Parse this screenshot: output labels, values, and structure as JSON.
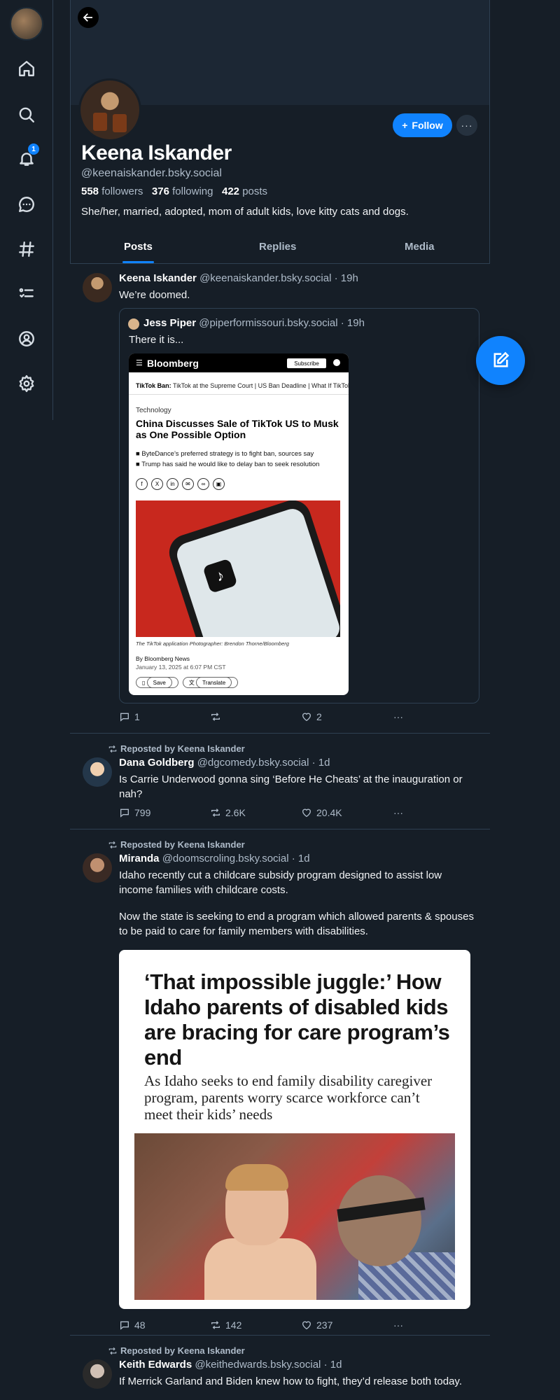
{
  "nav": {
    "items": [
      {
        "name": "home",
        "icon": "home-icon"
      },
      {
        "name": "search",
        "icon": "search-icon"
      },
      {
        "name": "notifications",
        "icon": "bell-icon",
        "badge": "1"
      },
      {
        "name": "chat",
        "icon": "chat-icon"
      },
      {
        "name": "feeds",
        "icon": "hashtag-icon"
      },
      {
        "name": "lists",
        "icon": "list-icon"
      },
      {
        "name": "profile",
        "icon": "user-icon"
      },
      {
        "name": "settings",
        "icon": "gear-icon"
      }
    ]
  },
  "profile": {
    "display_name": "Keena Iskander",
    "handle": "@keenaiskander.bsky.social",
    "followers_count": "558",
    "followers_label": "followers",
    "following_count": "376",
    "following_label": "following",
    "posts_count": "422",
    "posts_label": "posts",
    "bio": "She/her, married, adopted, mom of adult kids, love kitty cats and dogs.",
    "follow_label": "Follow",
    "more_label": "···"
  },
  "tabs": [
    {
      "label": "Posts",
      "active": true
    },
    {
      "label": "Replies",
      "active": false
    },
    {
      "label": "Media",
      "active": false
    }
  ],
  "posts": [
    {
      "author": "Keena Iskander",
      "handle": "@keenaiskander.bsky.social",
      "time": "· 19h",
      "text": "We’re doomed.",
      "quote": {
        "author": "Jess Piper",
        "handle": "@piperformissouri.bsky.social",
        "time": "· 19h",
        "text": "There it is...",
        "screenshot": {
          "brand": "Bloomberg",
          "subscribe": "Subscribe",
          "tags_label": "TikTok Ban:",
          "tags": "TikTok at the Supreme Court  |  US Ban Deadline  |  What If TikTok",
          "section": "Technology",
          "headline": "China Discusses Sale of TikTok US to Musk as One Possible Option",
          "bullet1": "ByteDance’s preferred strategy is to fight ban, sources say",
          "bullet2": "Trump has said he would like to delay ban to seek resolution",
          "caption": "The TikTok application  Photographer: Brendon Thorne/Bloomberg",
          "byline": "By Bloomberg News",
          "date": "January 13, 2025 at 6:07 PM CST",
          "save": "Save",
          "translate": "Translate"
        }
      },
      "replies": "1",
      "reposts": "",
      "likes": "2"
    },
    {
      "reposted_by": "Reposted by Keena Iskander",
      "author": "Dana Goldberg",
      "handle": "@dgcomedy.bsky.social",
      "time": "· 1d",
      "text": "Is Carrie Underwood gonna sing ‘Before He Cheats’ at the inauguration or nah?",
      "replies": "799",
      "reposts": "2.6K",
      "likes": "20.4K"
    },
    {
      "reposted_by": "Reposted by Keena Iskander",
      "author": "Miranda",
      "handle": "@doomscroling.bsky.social",
      "time": "· 1d",
      "text1": "Idaho recently cut a childcare subsidy program designed to assist low income families with childcare costs.",
      "text2": "Now the state is seeking to end a program which allowed parents & spouses to be paid to care for family members with disabilities.",
      "article": {
        "headline": "‘That impossible juggle:’ How Idaho parents of disabled kids are bracing for care program’s end",
        "subhead": "As Idaho seeks to end family disability caregiver program, parents worry scarce workforce can’t meet their kids’ needs"
      },
      "replies": "48",
      "reposts": "142",
      "likes": "237"
    },
    {
      "reposted_by": "Reposted by Keena Iskander",
      "author": "Keith Edwards",
      "handle": "@keithedwards.bsky.social",
      "time": "· 1d",
      "text": "If Merrick Garland and Biden knew how to fight, they’d release both today."
    }
  ],
  "colors": {
    "background": "#161e27",
    "accent": "#1083fe",
    "border": "#2e4052",
    "muted_text": "#aebbc9"
  }
}
